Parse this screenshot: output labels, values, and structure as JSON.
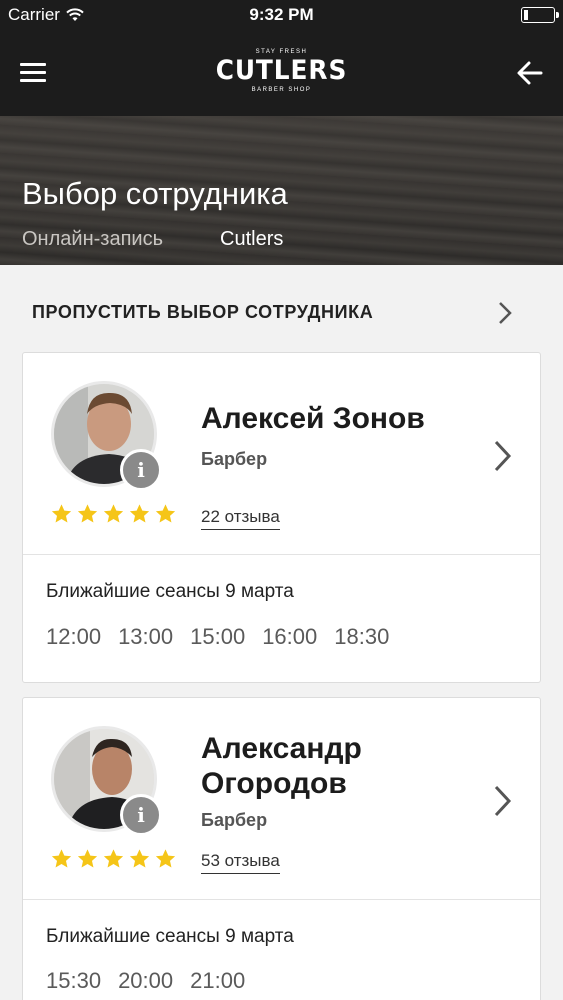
{
  "status_bar": {
    "carrier": "Carrier",
    "time": "9:32 PM"
  },
  "nav": {
    "logo_top": "STAY FRESH",
    "logo_brand": "CUTLERS",
    "logo_bottom": "BARBER SHOP"
  },
  "header": {
    "title": "Выбор сотрудника",
    "breadcrumb": [
      "Онлайн-запись",
      "Cutlers"
    ]
  },
  "skip": {
    "label": "ПРОПУСТИТЬ ВЫБОР СОТРУДНИКА"
  },
  "employees": [
    {
      "name": "Алексей Зонов",
      "role": "Барбер",
      "rating": 5,
      "reviews": "22 отзыва",
      "sessions_title": "Ближайшие сеансы 9 марта",
      "slots": [
        "12:00",
        "13:00",
        "15:00",
        "16:00",
        "18:30"
      ]
    },
    {
      "name": "Александр Огородов",
      "name_lines": [
        "Александр",
        "Огородов"
      ],
      "role": "Барбер",
      "rating": 5,
      "reviews": "53 отзыва",
      "sessions_title": "Ближайшие сеансы 9 марта",
      "slots": [
        "15:30",
        "20:00",
        "21:00"
      ]
    }
  ],
  "colors": {
    "bar_bg": "#1c1c1c",
    "star": "#f5c518",
    "info_badge": "#8a8a8a"
  }
}
